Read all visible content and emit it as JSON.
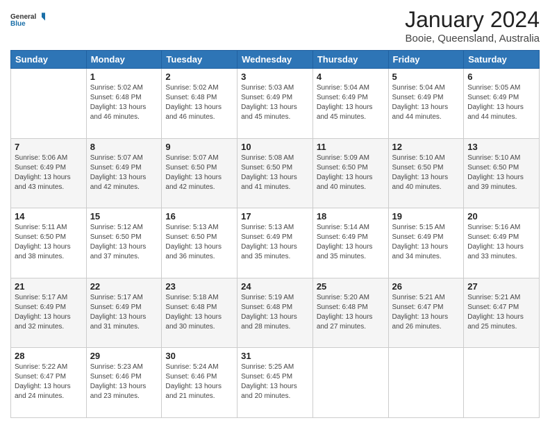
{
  "header": {
    "logo": {
      "line1": "General",
      "line2": "Blue"
    },
    "title": "January 2024",
    "subtitle": "Booie, Queensland, Australia"
  },
  "days_of_week": [
    "Sunday",
    "Monday",
    "Tuesday",
    "Wednesday",
    "Thursday",
    "Friday",
    "Saturday"
  ],
  "weeks": [
    [
      {
        "day": "",
        "info": ""
      },
      {
        "day": "1",
        "info": "Sunrise: 5:02 AM\nSunset: 6:48 PM\nDaylight: 13 hours\nand 46 minutes."
      },
      {
        "day": "2",
        "info": "Sunrise: 5:02 AM\nSunset: 6:48 PM\nDaylight: 13 hours\nand 46 minutes."
      },
      {
        "day": "3",
        "info": "Sunrise: 5:03 AM\nSunset: 6:49 PM\nDaylight: 13 hours\nand 45 minutes."
      },
      {
        "day": "4",
        "info": "Sunrise: 5:04 AM\nSunset: 6:49 PM\nDaylight: 13 hours\nand 45 minutes."
      },
      {
        "day": "5",
        "info": "Sunrise: 5:04 AM\nSunset: 6:49 PM\nDaylight: 13 hours\nand 44 minutes."
      },
      {
        "day": "6",
        "info": "Sunrise: 5:05 AM\nSunset: 6:49 PM\nDaylight: 13 hours\nand 44 minutes."
      }
    ],
    [
      {
        "day": "7",
        "info": "Sunrise: 5:06 AM\nSunset: 6:49 PM\nDaylight: 13 hours\nand 43 minutes."
      },
      {
        "day": "8",
        "info": "Sunrise: 5:07 AM\nSunset: 6:49 PM\nDaylight: 13 hours\nand 42 minutes."
      },
      {
        "day": "9",
        "info": "Sunrise: 5:07 AM\nSunset: 6:50 PM\nDaylight: 13 hours\nand 42 minutes."
      },
      {
        "day": "10",
        "info": "Sunrise: 5:08 AM\nSunset: 6:50 PM\nDaylight: 13 hours\nand 41 minutes."
      },
      {
        "day": "11",
        "info": "Sunrise: 5:09 AM\nSunset: 6:50 PM\nDaylight: 13 hours\nand 40 minutes."
      },
      {
        "day": "12",
        "info": "Sunrise: 5:10 AM\nSunset: 6:50 PM\nDaylight: 13 hours\nand 40 minutes."
      },
      {
        "day": "13",
        "info": "Sunrise: 5:10 AM\nSunset: 6:50 PM\nDaylight: 13 hours\nand 39 minutes."
      }
    ],
    [
      {
        "day": "14",
        "info": "Sunrise: 5:11 AM\nSunset: 6:50 PM\nDaylight: 13 hours\nand 38 minutes."
      },
      {
        "day": "15",
        "info": "Sunrise: 5:12 AM\nSunset: 6:50 PM\nDaylight: 13 hours\nand 37 minutes."
      },
      {
        "day": "16",
        "info": "Sunrise: 5:13 AM\nSunset: 6:50 PM\nDaylight: 13 hours\nand 36 minutes."
      },
      {
        "day": "17",
        "info": "Sunrise: 5:13 AM\nSunset: 6:49 PM\nDaylight: 13 hours\nand 35 minutes."
      },
      {
        "day": "18",
        "info": "Sunrise: 5:14 AM\nSunset: 6:49 PM\nDaylight: 13 hours\nand 35 minutes."
      },
      {
        "day": "19",
        "info": "Sunrise: 5:15 AM\nSunset: 6:49 PM\nDaylight: 13 hours\nand 34 minutes."
      },
      {
        "day": "20",
        "info": "Sunrise: 5:16 AM\nSunset: 6:49 PM\nDaylight: 13 hours\nand 33 minutes."
      }
    ],
    [
      {
        "day": "21",
        "info": "Sunrise: 5:17 AM\nSunset: 6:49 PM\nDaylight: 13 hours\nand 32 minutes."
      },
      {
        "day": "22",
        "info": "Sunrise: 5:17 AM\nSunset: 6:49 PM\nDaylight: 13 hours\nand 31 minutes."
      },
      {
        "day": "23",
        "info": "Sunrise: 5:18 AM\nSunset: 6:48 PM\nDaylight: 13 hours\nand 30 minutes."
      },
      {
        "day": "24",
        "info": "Sunrise: 5:19 AM\nSunset: 6:48 PM\nDaylight: 13 hours\nand 28 minutes."
      },
      {
        "day": "25",
        "info": "Sunrise: 5:20 AM\nSunset: 6:48 PM\nDaylight: 13 hours\nand 27 minutes."
      },
      {
        "day": "26",
        "info": "Sunrise: 5:21 AM\nSunset: 6:47 PM\nDaylight: 13 hours\nand 26 minutes."
      },
      {
        "day": "27",
        "info": "Sunrise: 5:21 AM\nSunset: 6:47 PM\nDaylight: 13 hours\nand 25 minutes."
      }
    ],
    [
      {
        "day": "28",
        "info": "Sunrise: 5:22 AM\nSunset: 6:47 PM\nDaylight: 13 hours\nand 24 minutes."
      },
      {
        "day": "29",
        "info": "Sunrise: 5:23 AM\nSunset: 6:46 PM\nDaylight: 13 hours\nand 23 minutes."
      },
      {
        "day": "30",
        "info": "Sunrise: 5:24 AM\nSunset: 6:46 PM\nDaylight: 13 hours\nand 21 minutes."
      },
      {
        "day": "31",
        "info": "Sunrise: 5:25 AM\nSunset: 6:45 PM\nDaylight: 13 hours\nand 20 minutes."
      },
      {
        "day": "",
        "info": ""
      },
      {
        "day": "",
        "info": ""
      },
      {
        "day": "",
        "info": ""
      }
    ]
  ]
}
